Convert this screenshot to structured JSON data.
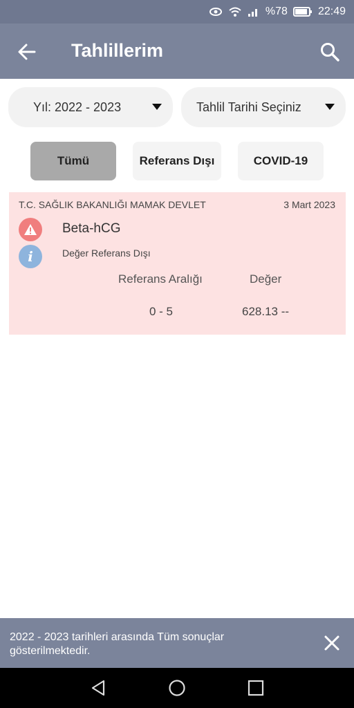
{
  "status_bar": {
    "battery": "%78",
    "time": "22:49"
  },
  "app_bar": {
    "title": "Tahlillerim"
  },
  "filters": {
    "year": "Yıl: 2022 - 2023",
    "date": "Tahlil Tarihi Seçiniz"
  },
  "tabs": [
    {
      "label": "Tümü",
      "selected": true
    },
    {
      "label": "Referans Dışı",
      "selected": false
    },
    {
      "label": "COVID-19",
      "selected": false
    }
  ],
  "result_card": {
    "institution": "T.C. SAĞLIK BAKANLIĞI MAMAK DEVLET",
    "date": "3 Mart 2023",
    "test_name": "Beta-hCG",
    "status": "Değer Referans Dışı",
    "range_header": "Referans Aralığı",
    "value_header": "Değer",
    "range": "0 - 5",
    "value": "628.13 --",
    "background_color": "#fde2e2"
  },
  "snackbar": {
    "message": "2022 - 2023 tarihleri arasında Tüm sonuçlar gösterilmektedir."
  },
  "colors": {
    "app_bar": "#7b849b",
    "warning": "#f07e7e",
    "info": "#8eb4dd"
  }
}
